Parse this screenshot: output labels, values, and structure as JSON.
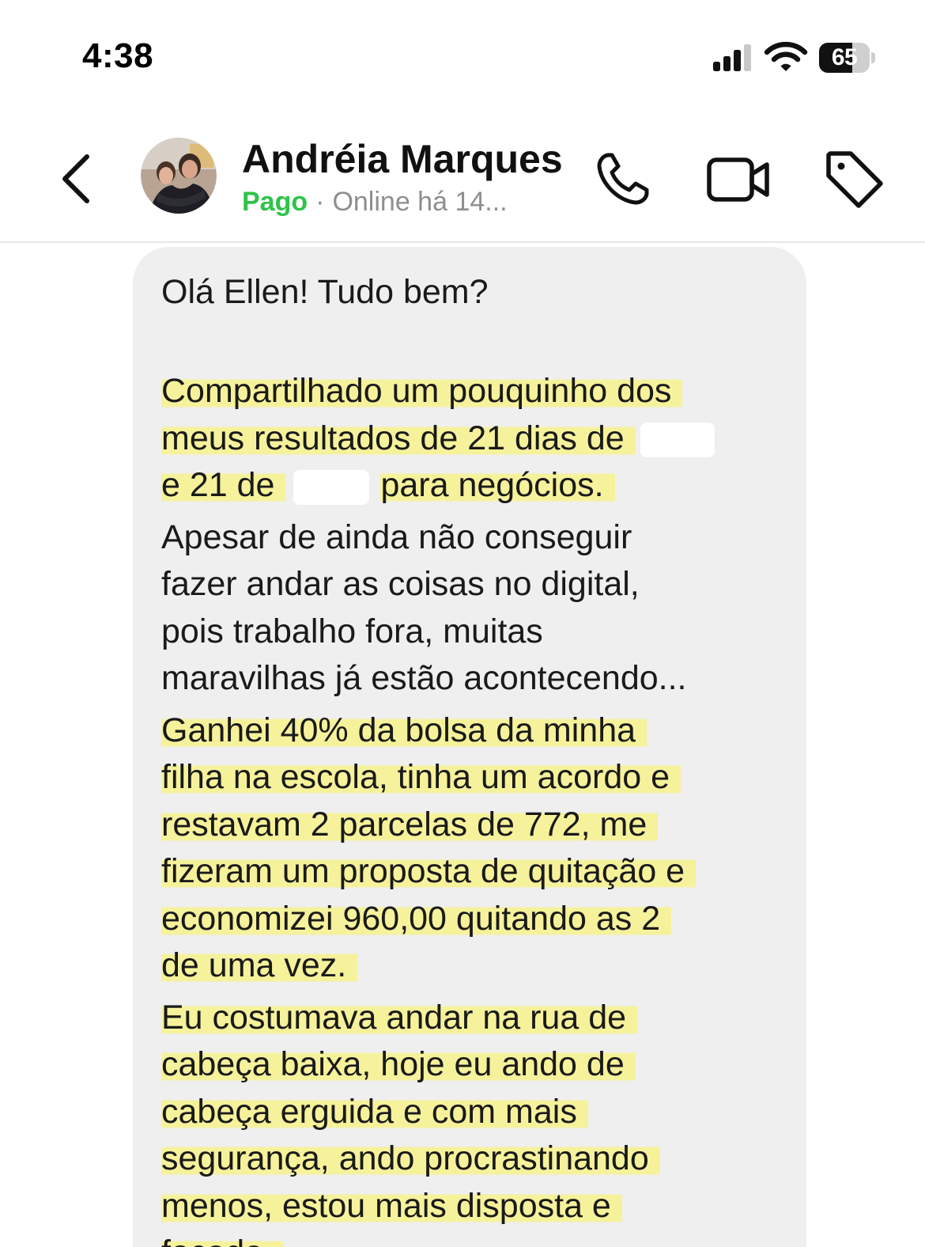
{
  "status_bar": {
    "time": "4:38",
    "battery_level": "65",
    "battery_fraction": 0.65,
    "icons": [
      "signal-icon",
      "wifi-icon",
      "battery-icon"
    ]
  },
  "header": {
    "contact_name": "Andréia Marques",
    "paid_label": "Pago",
    "separator": "·",
    "online_status": "Online há 14...",
    "icons": [
      "back-chevron-icon",
      "avatar",
      "phone-icon",
      "video-camera-icon",
      "tag-icon"
    ]
  },
  "colors": {
    "paid_green": "#2ec34a",
    "bubble_bg": "#efefef",
    "highlight": "#f7f28c",
    "muted_text": "#8e8e8e"
  },
  "message": {
    "greeting": "Olá Ellen! Tudo bem?",
    "p1_line1": "Compartilhado um pouquinho dos",
    "p1_line2": "meus resultados de 21 dias de",
    "p1_line3_start": "e 21 de",
    "p1_line3_end": "para negócios.",
    "p2": "Apesar de ainda não conseguir\nfazer andar as coisas no digital,\npois trabalho fora, muitas\nmaravilhas já estão acontecendo...",
    "p3": "Ganhei 40%  da bolsa da minha\nfilha na escola, tinha um acordo e\nrestavam 2 parcelas de 772, me\nfizeram um proposta de quitação e\neconomizei 960,00 quitando as 2\nde uma vez.",
    "p4": "Eu costumava andar na rua de\ncabeça baixa, hoje eu ando de\ncabeça erguida e com mais\nsegurança, ando procrastinando\nmenos, estou mais disposta e\nfocada."
  }
}
